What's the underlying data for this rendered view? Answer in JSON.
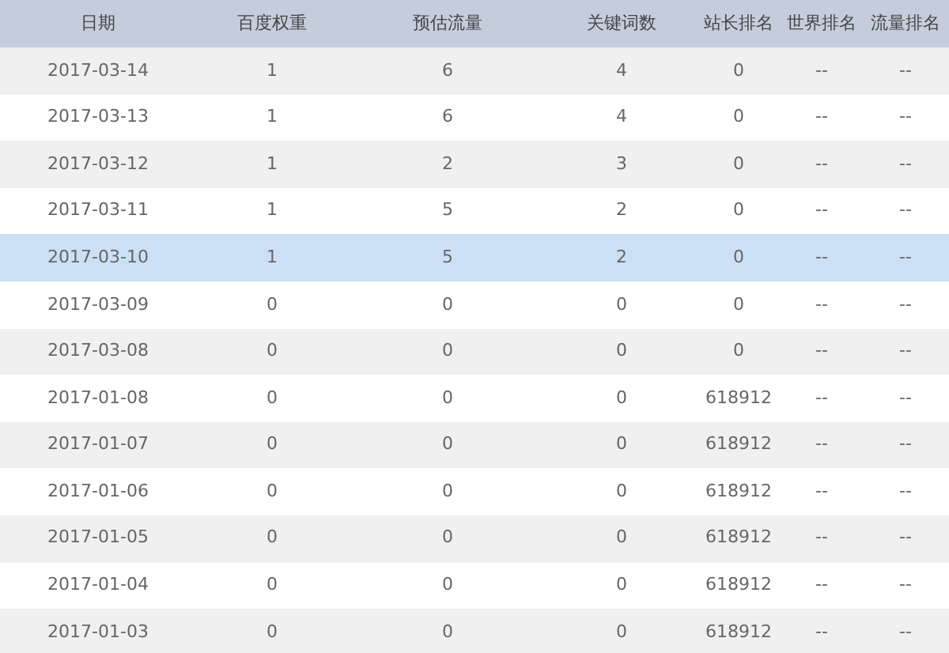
{
  "table": {
    "columns": [
      "日期",
      "百度权重",
      "预估流量",
      "关键词数",
      "站长排名",
      "世界排名",
      "流量排名"
    ],
    "rows": [
      {
        "cells": [
          "2017-03-14",
          "1",
          "6",
          "4",
          "0",
          "--",
          "--"
        ],
        "selected": false
      },
      {
        "cells": [
          "2017-03-13",
          "1",
          "6",
          "4",
          "0",
          "--",
          "--"
        ],
        "selected": false
      },
      {
        "cells": [
          "2017-03-12",
          "1",
          "2",
          "3",
          "0",
          "--",
          "--"
        ],
        "selected": false
      },
      {
        "cells": [
          "2017-03-11",
          "1",
          "5",
          "2",
          "0",
          "--",
          "--"
        ],
        "selected": false
      },
      {
        "cells": [
          "2017-03-10",
          "1",
          "5",
          "2",
          "0",
          "--",
          "--"
        ],
        "selected": true
      },
      {
        "cells": [
          "2017-03-09",
          "0",
          "0",
          "0",
          "0",
          "--",
          "--"
        ],
        "selected": false
      },
      {
        "cells": [
          "2017-03-08",
          "0",
          "0",
          "0",
          "0",
          "--",
          "--"
        ],
        "selected": false
      },
      {
        "cells": [
          "2017-01-08",
          "0",
          "0",
          "0",
          "618912",
          "--",
          "--"
        ],
        "selected": false
      },
      {
        "cells": [
          "2017-01-07",
          "0",
          "0",
          "0",
          "618912",
          "--",
          "--"
        ],
        "selected": false
      },
      {
        "cells": [
          "2017-01-06",
          "0",
          "0",
          "0",
          "618912",
          "--",
          "--"
        ],
        "selected": false
      },
      {
        "cells": [
          "2017-01-05",
          "0",
          "0",
          "0",
          "618912",
          "--",
          "--"
        ],
        "selected": false
      },
      {
        "cells": [
          "2017-01-04",
          "0",
          "0",
          "0",
          "618912",
          "--",
          "--"
        ],
        "selected": false
      },
      {
        "cells": [
          "2017-01-03",
          "0",
          "0",
          "0",
          "618912",
          "--",
          "--"
        ],
        "selected": false
      }
    ]
  }
}
